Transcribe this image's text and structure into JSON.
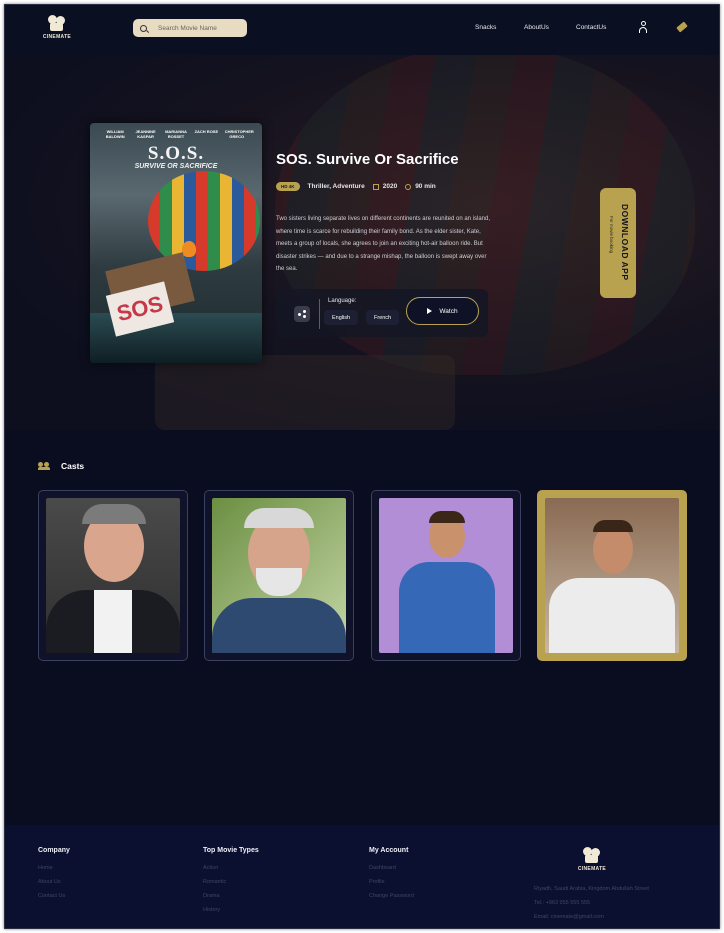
{
  "header": {
    "logo_text": "CINEMATE",
    "search_placeholder": "Search Movie Name",
    "nav": [
      "Snacks",
      "AboutUs",
      "ContactUs"
    ],
    "icons": [
      "search-icon",
      "user-icon",
      "ticket-icon"
    ]
  },
  "movie": {
    "poster": {
      "actors": [
        "WILLIAM BALDWIN",
        "JEANNINE KASPAR",
        "MARIANNA ROSSET",
        "ZACH ROSE",
        "CHRISTOPHER GRECO"
      ],
      "title": "S.O.S.",
      "subtitle": "SURVIVE OR SACRIFICE",
      "sign_text": "SOS"
    },
    "title": "SOS. Survive Or Sacrifice",
    "quality": "HD 4K",
    "genres": "Thriller, Adventure",
    "year": "2020",
    "duration": "90 min",
    "description": "Two sisters living separate lives on different continents are reunited on an island, where time is scarce for rebuilding their family bond. As the elder sister, Kate, meets a group of locals, she agrees to join an exciting hot-air balloon ride. But disaster strikes — and due to a strange mishap, the balloon is swept away over the sea.",
    "language_label": "Language:",
    "languages": [
      "English",
      "French"
    ],
    "watch_label": "Watch"
  },
  "download": {
    "label": "DOWNLOAD APP",
    "sub": "For movie booking"
  },
  "casts": {
    "title": "Casts",
    "cards": [
      {
        "name": "cast-1",
        "active": false
      },
      {
        "name": "cast-2",
        "active": false
      },
      {
        "name": "cast-3",
        "active": false
      },
      {
        "name": "cast-4",
        "active": true
      }
    ]
  },
  "footer": {
    "company": {
      "title": "Company",
      "links": [
        "Home",
        "About Us",
        "Contact Us"
      ]
    },
    "types": {
      "title": "Top Movie Types",
      "links": [
        "Action",
        "Romantic",
        "Drama",
        "History"
      ]
    },
    "account": {
      "title": "My Account",
      "links": [
        "Dashboard",
        "Profile",
        "Change Password"
      ]
    },
    "logo_text": "CINEMATE",
    "address": "Riyadh, Saudi Arabia, Kingdom Abdullah Street",
    "phone": "Tel.: +963 955 555 555",
    "email": "Email: cinemate@gmail.com"
  },
  "colors": {
    "accent": "#b9a24f",
    "background": "#0a0d1f",
    "footer": "#0c1030"
  }
}
